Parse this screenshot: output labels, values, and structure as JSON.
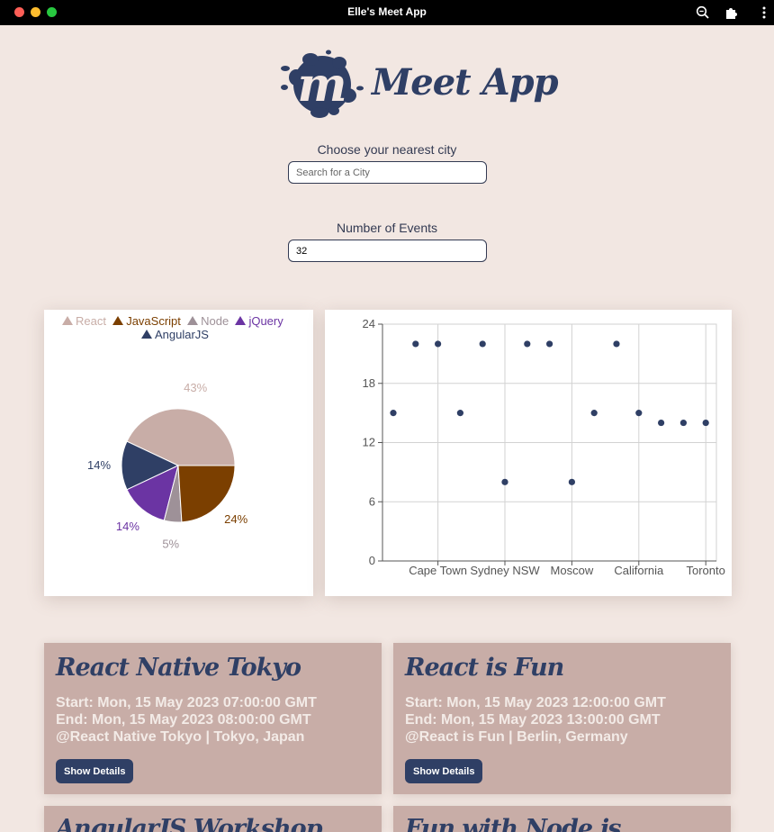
{
  "window": {
    "title": "Elle's Meet App"
  },
  "app": {
    "name": "Meet App",
    "logo_letter": "m"
  },
  "city_search": {
    "label": "Choose your nearest city",
    "placeholder": "Search for a City"
  },
  "events_count": {
    "label": "Number of Events",
    "value": "32"
  },
  "pie_chart": {
    "chart_data": {
      "type": "pie",
      "legend": [
        "React",
        "JavaScript",
        "Node",
        "jQuery",
        "AngularJS"
      ],
      "slices": [
        {
          "name": "React",
          "value": 43,
          "label": "43%",
          "color": "#c8ada7"
        },
        {
          "name": "AngularJS",
          "value": 14,
          "label": "14%",
          "color": "#2f3f65"
        },
        {
          "name": "jQuery",
          "value": 14,
          "label": "14%",
          "color": "#6b34a3"
        },
        {
          "name": "Node",
          "value": 5,
          "label": "5%",
          "color": "#9e9198"
        },
        {
          "name": "JavaScript",
          "value": 24,
          "label": "24%",
          "color": "#7b3f00"
        }
      ]
    }
  },
  "scatter_chart": {
    "chart_data": {
      "type": "scatter",
      "x_tick_labels": [
        "Cape Town",
        "Sydney NSW",
        "Moscow",
        "California",
        "Toronto"
      ],
      "y_ticks": [
        0,
        6,
        12,
        18,
        24
      ],
      "ylim": [
        0,
        24
      ],
      "grid": true,
      "point_color": "#2f3f65",
      "points": [
        {
          "x": 0,
          "y": 15
        },
        {
          "x": 1,
          "y": 22
        },
        {
          "x": 2,
          "y": 22
        },
        {
          "x": 3,
          "y": 15
        },
        {
          "x": 4,
          "y": 22
        },
        {
          "x": 5,
          "y": 8
        },
        {
          "x": 6,
          "y": 22
        },
        {
          "x": 7,
          "y": 22
        },
        {
          "x": 8,
          "y": 8
        },
        {
          "x": 9,
          "y": 15
        },
        {
          "x": 10,
          "y": 22
        },
        {
          "x": 11,
          "y": 15
        },
        {
          "x": 12,
          "y": 14
        },
        {
          "x": 13,
          "y": 14
        },
        {
          "x": 14,
          "y": 14
        }
      ]
    }
  },
  "events": [
    {
      "title": "React Native Tokyo",
      "start": "Start: Mon, 15 May 2023 07:00:00 GMT",
      "end": "End: Mon, 15 May 2023 08:00:00 GMT",
      "location": "@React Native Tokyo | Tokyo, Japan",
      "button": "Show Details"
    },
    {
      "title": "React is Fun",
      "start": "Start: Mon, 15 May 2023 12:00:00 GMT",
      "end": "End: Mon, 15 May 2023 13:00:00 GMT",
      "location": "@React is Fun | Berlin, Germany",
      "button": "Show Details"
    },
    {
      "title": "AngularJS Workshop"
    },
    {
      "title": "Fun with Node.js"
    }
  ]
}
